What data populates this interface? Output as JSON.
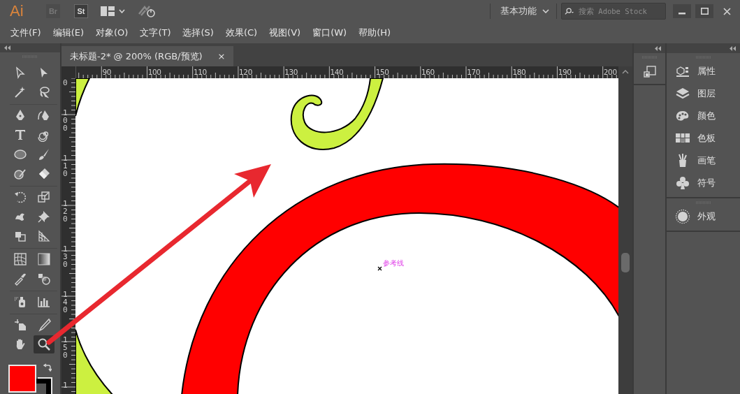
{
  "window": {
    "app_logo": "Ai",
    "apps": [
      {
        "label": "Br",
        "disabled": true
      },
      {
        "label": "St",
        "disabled": false
      }
    ],
    "workspace": "基本功能",
    "search": {
      "placeholder": "搜索 Adobe Stock"
    }
  },
  "menu": [
    "文件(F)",
    "编辑(E)",
    "对象(O)",
    "文字(T)",
    "选择(S)",
    "效果(C)",
    "视图(V)",
    "窗口(W)",
    "帮助(H)"
  ],
  "document_tab": {
    "title": "未标题-2* @ 200% (RGB/预览)",
    "close": "×",
    "selected": true
  },
  "rulers": {
    "horizontal": [
      "90",
      "100",
      "110",
      "120",
      "130",
      "140",
      "150",
      "160",
      "170",
      "180",
      "190",
      "200"
    ],
    "vertical": [
      "0",
      "100",
      "110",
      "120",
      "130",
      "140",
      "150",
      "1"
    ]
  },
  "tool_groups": [
    [
      {
        "kind": "direct-select",
        "selected": false
      },
      {
        "kind": "select",
        "selected": false
      },
      {
        "kind": "magic-wand",
        "selected": false
      },
      {
        "kind": "lasso",
        "selected": false
      }
    ],
    [
      {
        "kind": "pen",
        "selected": false
      },
      {
        "kind": "curvature",
        "selected": false
      },
      {
        "kind": "type",
        "selected": false
      },
      {
        "kind": "spiral",
        "selected": false
      },
      {
        "kind": "ellipse",
        "selected": false
      },
      {
        "kind": "brush",
        "selected": false
      },
      {
        "kind": "shaper",
        "selected": false
      },
      {
        "kind": "eraser",
        "selected": false
      }
    ],
    [
      {
        "kind": "rotate",
        "selected": false
      },
      {
        "kind": "scale",
        "selected": false
      },
      {
        "kind": "warp",
        "selected": false
      },
      {
        "kind": "pin",
        "selected": false
      },
      {
        "kind": "shape-builder",
        "selected": false
      },
      {
        "kind": "perspective",
        "selected": false
      }
    ],
    [
      {
        "kind": "mesh",
        "selected": false
      },
      {
        "kind": "gradient",
        "selected": false
      },
      {
        "kind": "eyedropper",
        "selected": false
      },
      {
        "kind": "blend",
        "selected": false
      }
    ],
    [
      {
        "kind": "sprayer",
        "selected": false
      },
      {
        "kind": "graph",
        "selected": false
      }
    ],
    [
      {
        "kind": "artboard",
        "selected": false
      },
      {
        "kind": "knife",
        "selected": false
      },
      {
        "kind": "hand",
        "selected": false
      },
      {
        "kind": "zoom",
        "selected": true
      }
    ]
  ],
  "swatches": [
    {
      "kind": "fill",
      "color": "#ff0000"
    },
    {
      "kind": "stroke",
      "color": "#000000"
    }
  ],
  "canvas": {
    "guide_label": "参考线"
  },
  "panels": [
    {
      "items": [
        {
          "kind": "properties",
          "label": "属性"
        },
        {
          "kind": "layers",
          "label": "图层"
        },
        {
          "kind": "color",
          "label": "颜色"
        },
        {
          "kind": "swatches",
          "label": "色板"
        },
        {
          "kind": "brushes",
          "label": "画笔"
        },
        {
          "kind": "symbols",
          "label": "符号"
        }
      ]
    },
    {
      "items": [
        {
          "kind": "appearance",
          "label": "外观"
        }
      ]
    }
  ]
}
